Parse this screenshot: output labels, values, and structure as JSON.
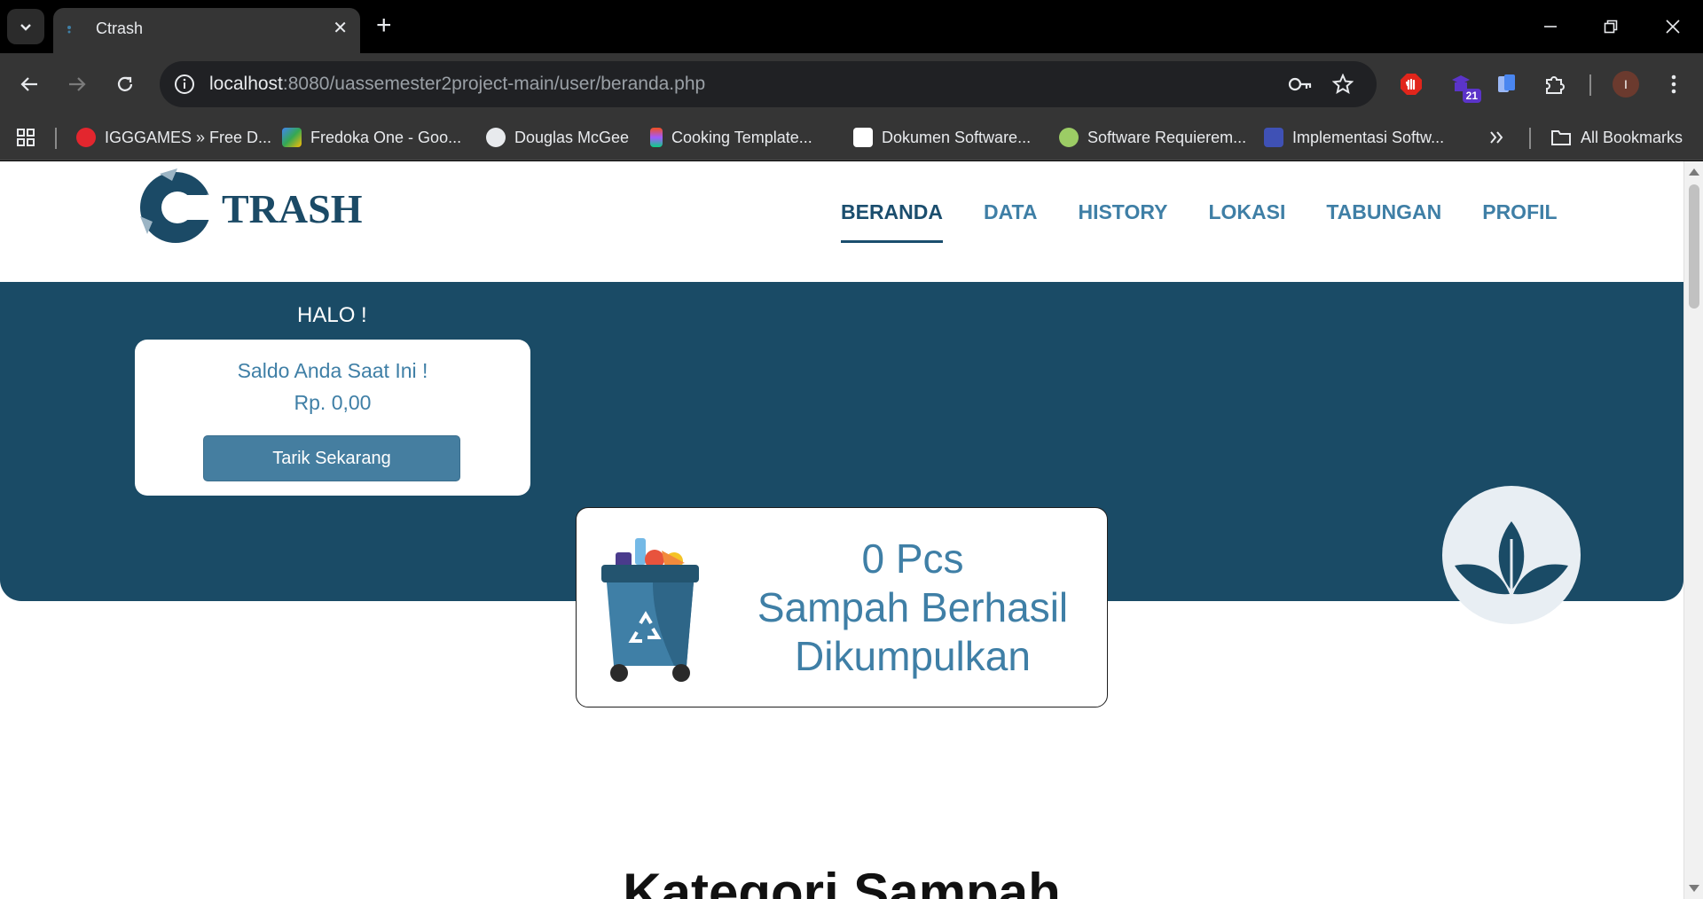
{
  "browser": {
    "tab_title": "Ctrash",
    "url_host": "localhost",
    "url_rest": ":8080/uassemester2project-main/user/beranda.php",
    "extension_badge": "21",
    "profile_initial": "I",
    "bookmarks": [
      {
        "label": "IGGGAMES » Free D...",
        "icon": "igg-icon",
        "color": "#e3262e"
      },
      {
        "label": "Fredoka One - Goo...",
        "icon": "google-fonts-icon",
        "color": "#4285f4"
      },
      {
        "label": "Douglas McGee",
        "icon": "globe-icon",
        "color": "#e8eaed"
      },
      {
        "label": "Cooking Template...",
        "icon": "figma-icon",
        "color": "#f24e1e"
      },
      {
        "label": "Dokumen Software...",
        "icon": "pkp-icon",
        "color": "#ffffff"
      },
      {
        "label": "Software Requierem...",
        "icon": "site-icon",
        "color": "#9ccc65"
      },
      {
        "label": "Implementasi Softw...",
        "icon": "site-icon",
        "color": "#3f51b5"
      }
    ],
    "all_bookmarks_label": "All Bookmarks"
  },
  "site": {
    "logo_text": "TRASH",
    "nav": [
      "BERANDA",
      "DATA",
      "HISTORY",
      "LOKASI",
      "TABUNGAN",
      "PROFIL"
    ],
    "active_nav": "BERANDA"
  },
  "hero": {
    "greeting": "HALO !",
    "saldo_title": "Saldo Anda Saat Ini !",
    "saldo_amount": "Rp. 0,00",
    "withdraw_label": "Tarik Sekarang"
  },
  "stats": {
    "count": "0 Pcs",
    "label_line1": "Sampah Berhasil",
    "label_line2": "Dikumpulkan"
  },
  "section_title": "Kategori Sampah",
  "colors": {
    "primary_dark": "#1a4b66",
    "primary": "#3f7fa6",
    "button": "#457ea0"
  }
}
